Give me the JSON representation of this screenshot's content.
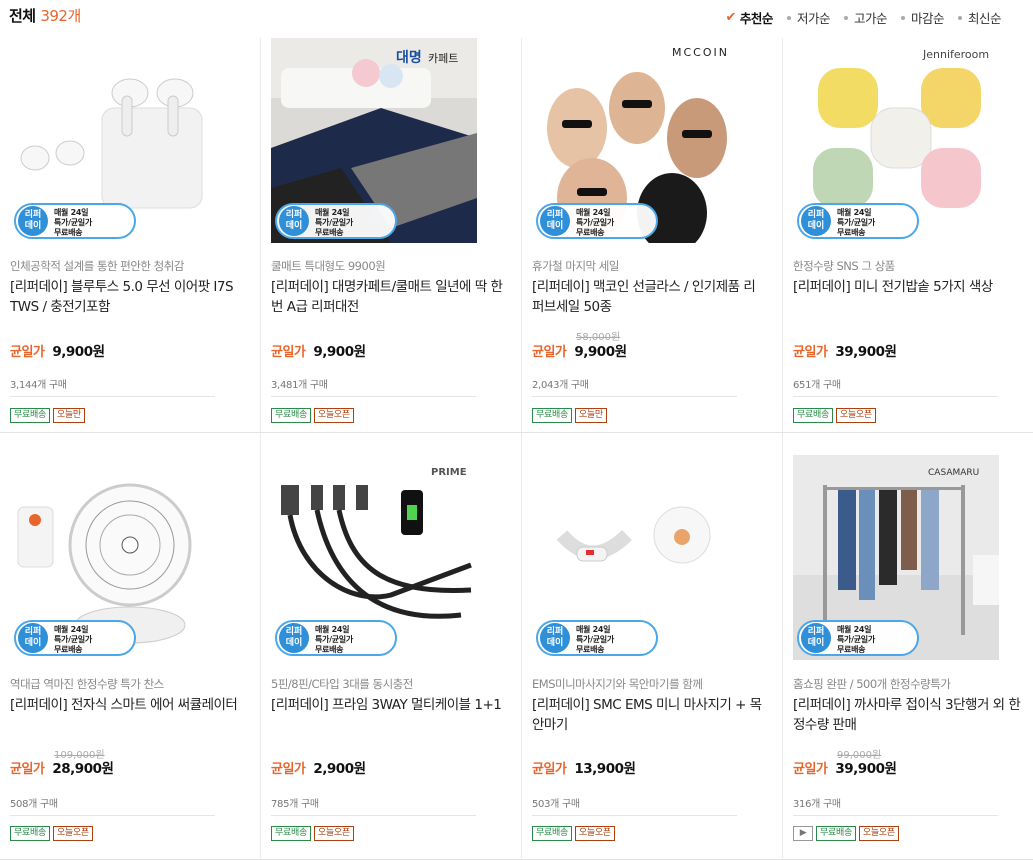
{
  "header": {
    "total_label": "전체",
    "total_count": "392개",
    "sort_options": [
      {
        "label": "추천순",
        "active": true
      },
      {
        "label": "저가순",
        "active": false
      },
      {
        "label": "고가순",
        "active": false
      },
      {
        "label": "마감순",
        "active": false
      },
      {
        "label": "최신순",
        "active": false
      }
    ]
  },
  "badge": {
    "circle_text": "리퍼\n데이",
    "text": "매월 24일\n특가/균일가\n무료배송"
  },
  "colors": {
    "accent": "#e8652b",
    "badge_blue": "#2f8fd8"
  },
  "products": [
    {
      "subtitle": "인체공학적 설계를 통한 편안한 청취감",
      "title": "[리퍼데이] 블루투스 5.0 무선 이어팟 I7S TWS / 충전기포함",
      "original_price": "",
      "price_label": "균일가",
      "price": "9,900원",
      "sold": "3,144개 구매",
      "tags": [
        "무료배송",
        "오늘만"
      ],
      "thumb_text": "",
      "thumb_icon": "earbuds-image"
    },
    {
      "subtitle": "쿨매트 특대형도 9900원",
      "title": "[리퍼데이] 대명카페트/쿨매트 일년에 딱 한번 A급 리퍼대전",
      "original_price": "",
      "price_label": "균일가",
      "price": "9,900원",
      "sold": "3,481개 구매",
      "tags": [
        "무료배송",
        "오늘오픈"
      ],
      "thumb_text": "대명카페트",
      "thumb_icon": "carpet-image"
    },
    {
      "subtitle": "휴가철 마지막 세일",
      "title": "[리퍼데이] 맥코인 선글라스 / 인기제품 리퍼브세일 50종",
      "original_price": "58,000원",
      "price_label": "균일가",
      "price": "9,900원",
      "sold": "2,043개 구매",
      "tags": [
        "무료배송",
        "오늘만"
      ],
      "thumb_text": "MCCOIN",
      "thumb_icon": "sunglasses-image"
    },
    {
      "subtitle": "한정수량 SNS 그 상품",
      "title": "[리퍼데이] 미니 전기밥솥 5가지 색상",
      "original_price": "",
      "price_label": "균일가",
      "price": "39,900원",
      "sold": "651개 구매",
      "tags": [
        "무료배송",
        "오늘오픈"
      ],
      "thumb_text": "Jenniferoom",
      "thumb_icon": "rice-cooker-image"
    },
    {
      "subtitle": "역대급 역마진 한정수량 특가 찬스",
      "title": "[리퍼데이] 전자식 스마트 에어 써큘레이터",
      "original_price": "109,000원",
      "price_label": "균일가",
      "price": "28,900원",
      "sold": "508개 구매",
      "tags": [
        "무료배송",
        "오늘오픈"
      ],
      "thumb_text": "",
      "thumb_icon": "fan-image"
    },
    {
      "subtitle": "5핀/8핀/C타입 3대를 동시충전",
      "title": "[리퍼데이] 프라임 3WAY 멀티케이블 1+1",
      "original_price": "",
      "price_label": "균일가",
      "price": "2,900원",
      "sold": "785개 구매",
      "tags": [
        "무료배송",
        "오늘오픈"
      ],
      "thumb_text": "PRIME",
      "thumb_icon": "cable-image"
    },
    {
      "subtitle": "EMS미니마사지기와 목안마기를 함께",
      "title": "[리퍼데이] SMC EMS 미니 마사지기 + 목안마기",
      "original_price": "",
      "price_label": "균일가",
      "price": "13,900원",
      "sold": "503개 구매",
      "tags": [
        "무료배송",
        "오늘오픈"
      ],
      "thumb_text": "",
      "thumb_icon": "massager-image"
    },
    {
      "subtitle": "홈쇼핑 완판 / 500개 한정수량특가",
      "title": "[리퍼데이] 까사마루 접이식 3단행거 외 한정수량 판매",
      "original_price": "99,000원",
      "price_label": "균일가",
      "price": "39,900원",
      "sold": "316개 구매",
      "tags": [
        "무료배송",
        "오늘오픈"
      ],
      "thumb_text": "CASAMARU",
      "thumb_icon": "hanger-image",
      "has_video": true
    }
  ]
}
